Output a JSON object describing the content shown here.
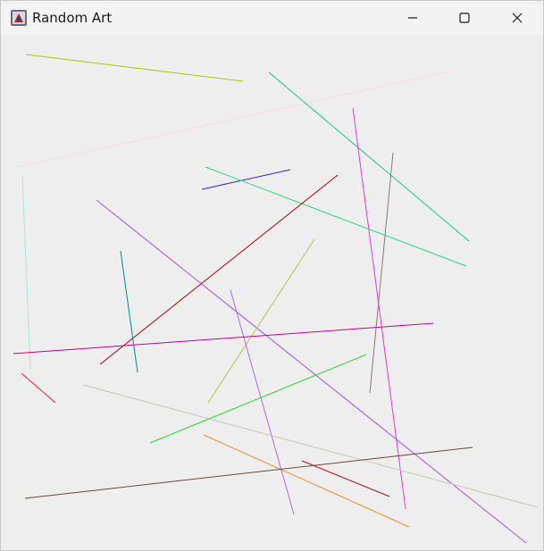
{
  "window": {
    "title": "Random Art",
    "controls": {
      "minimize_icon": "minimize-icon",
      "maximize_icon": "maximize-icon",
      "close_icon": "close-icon"
    }
  },
  "canvas": {
    "background": "#eeeeee",
    "lines": [
      {
        "color": "#a8c800"
      },
      {
        "color": "#ffd9e0"
      },
      {
        "color": "#12c98a"
      },
      {
        "color": "#e23bd6"
      },
      {
        "color": "#8a7a7a"
      },
      {
        "color": "#3a1fd0"
      },
      {
        "color": "#2bd57a"
      },
      {
        "color": "#b70000"
      },
      {
        "color": "#a050e8"
      },
      {
        "color": "#008a94"
      },
      {
        "color": "#b0c850"
      },
      {
        "color": "#a6e8dc"
      },
      {
        "color": "#a86af0"
      },
      {
        "color": "#c8008c"
      },
      {
        "color": "#ff2020"
      },
      {
        "color": "#c8c8b4"
      },
      {
        "color": "#2ad62a"
      },
      {
        "color": "#f08a30"
      },
      {
        "color": "#b81010"
      },
      {
        "color": "#6a4a3a"
      }
    ]
  }
}
